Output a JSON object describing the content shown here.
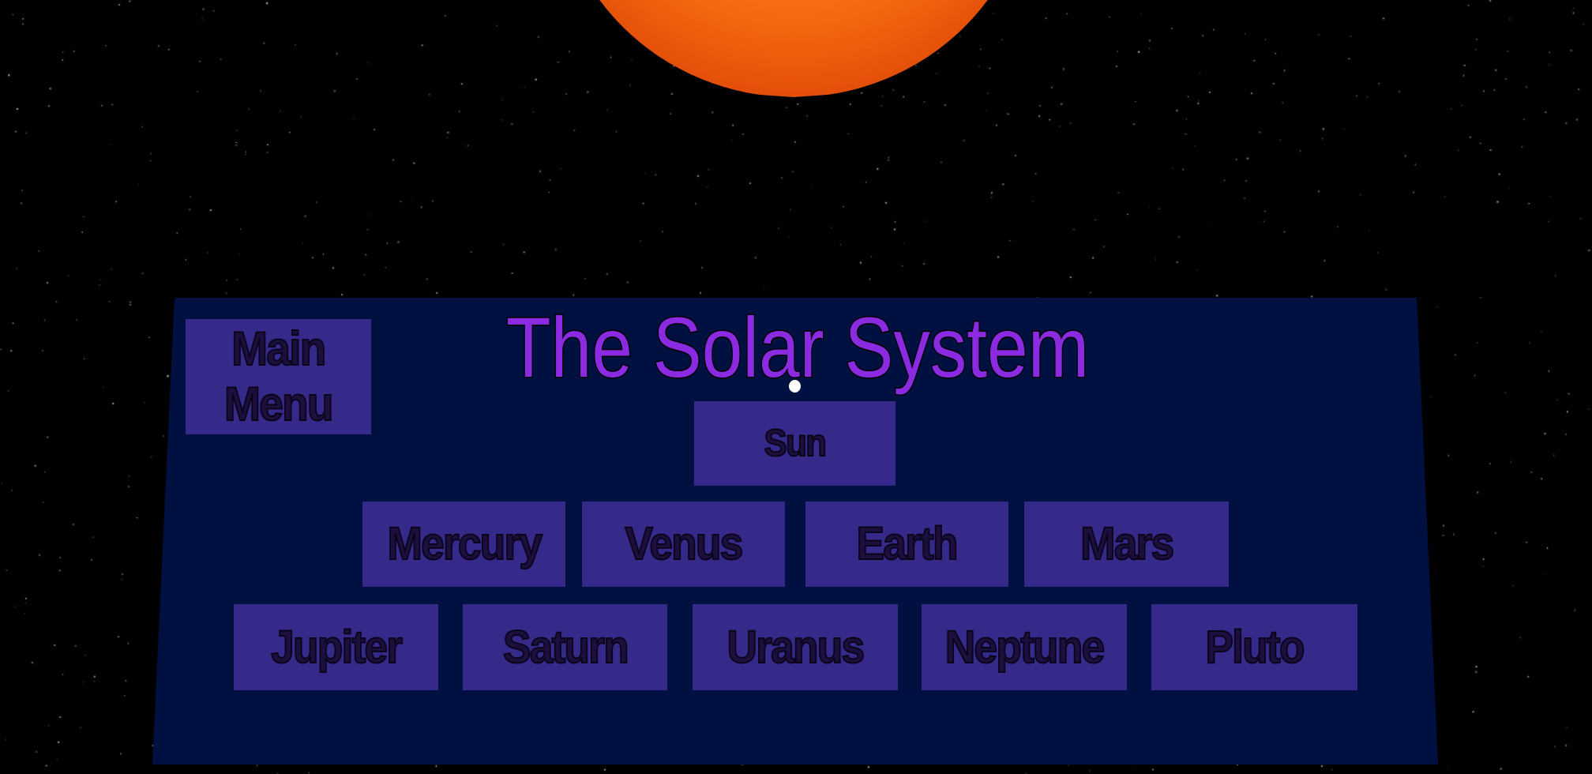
{
  "scene": {
    "background_color": "#000000",
    "panel_color": "#001040",
    "button_color": "#352a8a",
    "title_color": "#8a2be2"
  },
  "menu": {
    "title": "The Solar System",
    "main_menu_label": "Main\nMenu",
    "sun_label": "Sun",
    "row1": [
      "Mercury",
      "Venus",
      "Earth",
      "Mars"
    ],
    "row2": [
      "Jupiter",
      "Saturn",
      "Uranus",
      "Neptune",
      "Pluto"
    ]
  }
}
